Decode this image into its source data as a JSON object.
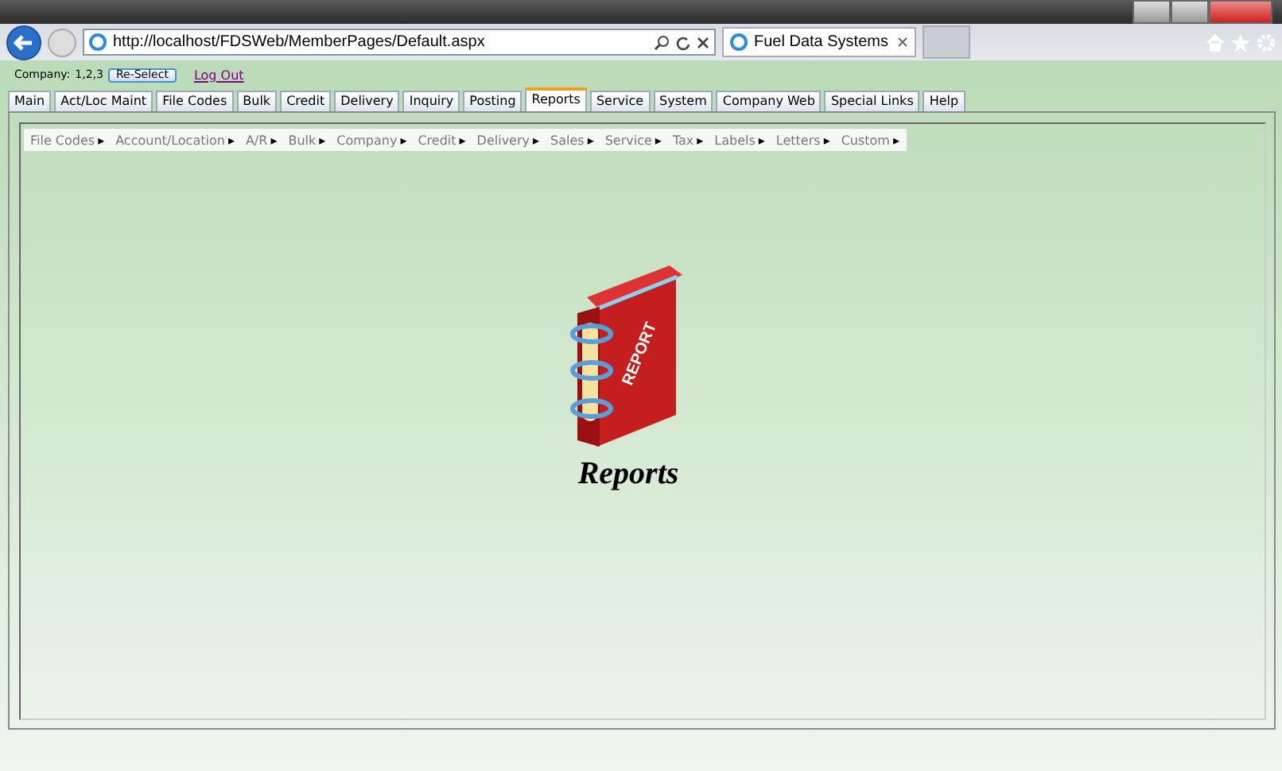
{
  "browser": {
    "address": "http://localhost/FDSWeb/MemberPages/Default.aspx",
    "tab_title": "Fuel Data Systems"
  },
  "header": {
    "company_label": "Company:",
    "company_value": "1,2,3",
    "reselect_button": "Re-Select",
    "logout_link": "Log Out"
  },
  "tabs": [
    {
      "label": "Main",
      "selected": false
    },
    {
      "label": "Act/Loc Maint",
      "selected": false
    },
    {
      "label": "File Codes",
      "selected": false
    },
    {
      "label": "Bulk",
      "selected": false
    },
    {
      "label": "Credit",
      "selected": false
    },
    {
      "label": "Delivery",
      "selected": false
    },
    {
      "label": "Inquiry",
      "selected": false
    },
    {
      "label": "Posting",
      "selected": false
    },
    {
      "label": "Reports",
      "selected": true
    },
    {
      "label": "Service",
      "selected": false
    },
    {
      "label": "System",
      "selected": false
    },
    {
      "label": "Company Web",
      "selected": false
    },
    {
      "label": "Special Links",
      "selected": false
    },
    {
      "label": "Help",
      "selected": false
    }
  ],
  "menu": [
    {
      "label": "File Codes",
      "arrow": "▸"
    },
    {
      "label": "Account/Location",
      "arrow": "▸"
    },
    {
      "label": "A/R",
      "arrow": "▸"
    },
    {
      "label": "Bulk",
      "arrow": "▸"
    },
    {
      "label": "Company",
      "arrow": "▸"
    },
    {
      "label": "Credit",
      "arrow": "▸"
    },
    {
      "label": "Delivery",
      "arrow": "▸"
    },
    {
      "label": "Sales",
      "arrow": "▸"
    },
    {
      "label": "Service",
      "arrow": "▸"
    },
    {
      "label": "Tax",
      "arrow": "▸"
    },
    {
      "label": "Labels",
      "arrow": "▸"
    },
    {
      "label": "Letters",
      "arrow": "▸"
    },
    {
      "label": "Custom",
      "arrow": "▸"
    }
  ],
  "hero": {
    "book_label": "REPORT",
    "title": "Reports"
  }
}
